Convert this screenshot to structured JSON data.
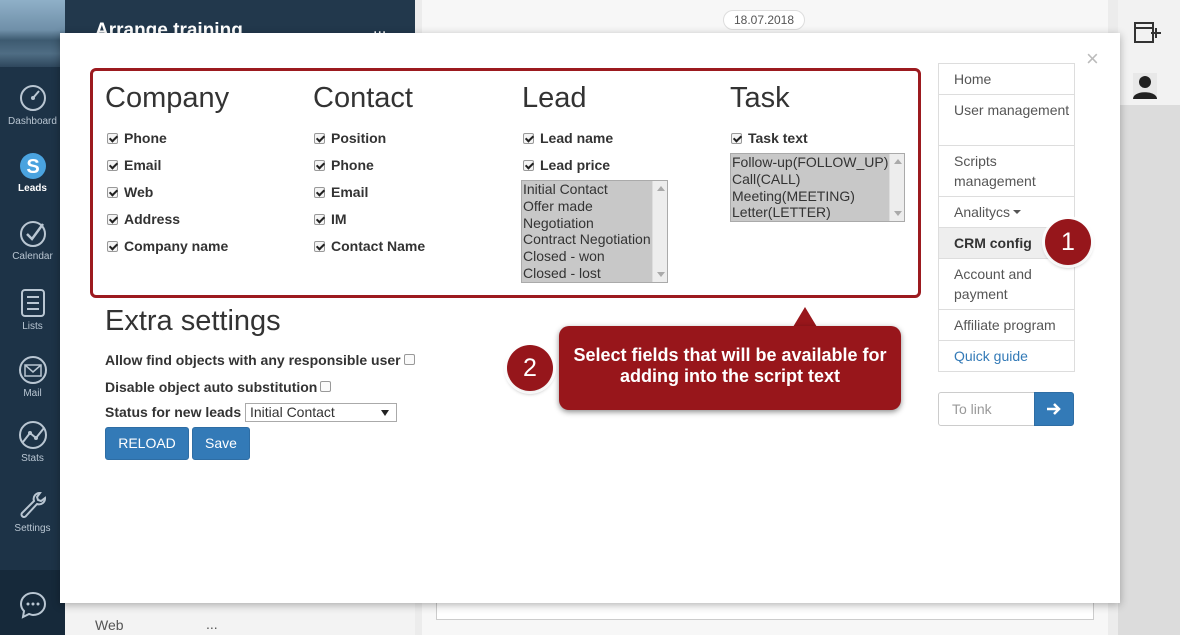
{
  "app": {
    "panel_title": "Arrange training",
    "panel_menu": "...",
    "date": "18.07.2018",
    "lower_row": {
      "name": "Web",
      "more": "..."
    }
  },
  "nav": {
    "items": [
      {
        "label": "Dashboard",
        "icon": "dashboard-icon"
      },
      {
        "label": "Leads",
        "icon": "leads-icon",
        "active": true
      },
      {
        "label": "Calendar",
        "icon": "calendar-icon"
      },
      {
        "label": "Lists",
        "icon": "lists-icon"
      },
      {
        "label": "Mail",
        "icon": "mail-icon"
      },
      {
        "label": "Stats",
        "icon": "stats-icon"
      },
      {
        "label": "Settings",
        "icon": "settings-icon"
      }
    ]
  },
  "modal": {
    "close": "×",
    "columns": {
      "company": {
        "title": "Company",
        "fields": [
          "Phone",
          "Email",
          "Web",
          "Address",
          "Company name"
        ]
      },
      "contact": {
        "title": "Contact",
        "fields": [
          "Position",
          "Phone",
          "Email",
          "IM",
          "Contact Name"
        ]
      },
      "lead": {
        "title": "Lead",
        "fields": [
          "Lead name",
          "Lead price"
        ],
        "statuses": [
          "Initial Contact",
          "Offer made",
          "Negotiation",
          "Contract Negotiation",
          "Closed - won",
          "Closed - lost"
        ]
      },
      "task": {
        "title": "Task",
        "fields": [
          "Task text"
        ],
        "types": [
          "Follow-up(FOLLOW_UP)",
          "Call(CALL)",
          "Meeting(MEETING)",
          "Letter(LETTER)"
        ]
      }
    },
    "extra": {
      "title": "Extra settings",
      "allow_find": "Allow find objects with any responsible user",
      "disable_sub": "Disable object auto substitution",
      "status_label": "Status for new leads",
      "status_value": "Initial Contact",
      "reload": "RELOAD",
      "save": "Save"
    }
  },
  "side_menu": {
    "home": "Home",
    "user_management": "User management",
    "scripts_management": "Scripts management",
    "analytics": "Analitycs",
    "crm_config": "CRM config",
    "account_payment": "Account and payment",
    "affiliate": "Affiliate program",
    "quick_guide": "Quick guide",
    "to_link_placeholder": "To link"
  },
  "callouts": {
    "badge1": "1",
    "badge2": "2",
    "bubble": "Select fields that will be available for adding into the script text"
  },
  "colors": {
    "accent_blue": "#337ab7",
    "callout_red": "#98161b",
    "nav_dark": "#1d3347"
  }
}
